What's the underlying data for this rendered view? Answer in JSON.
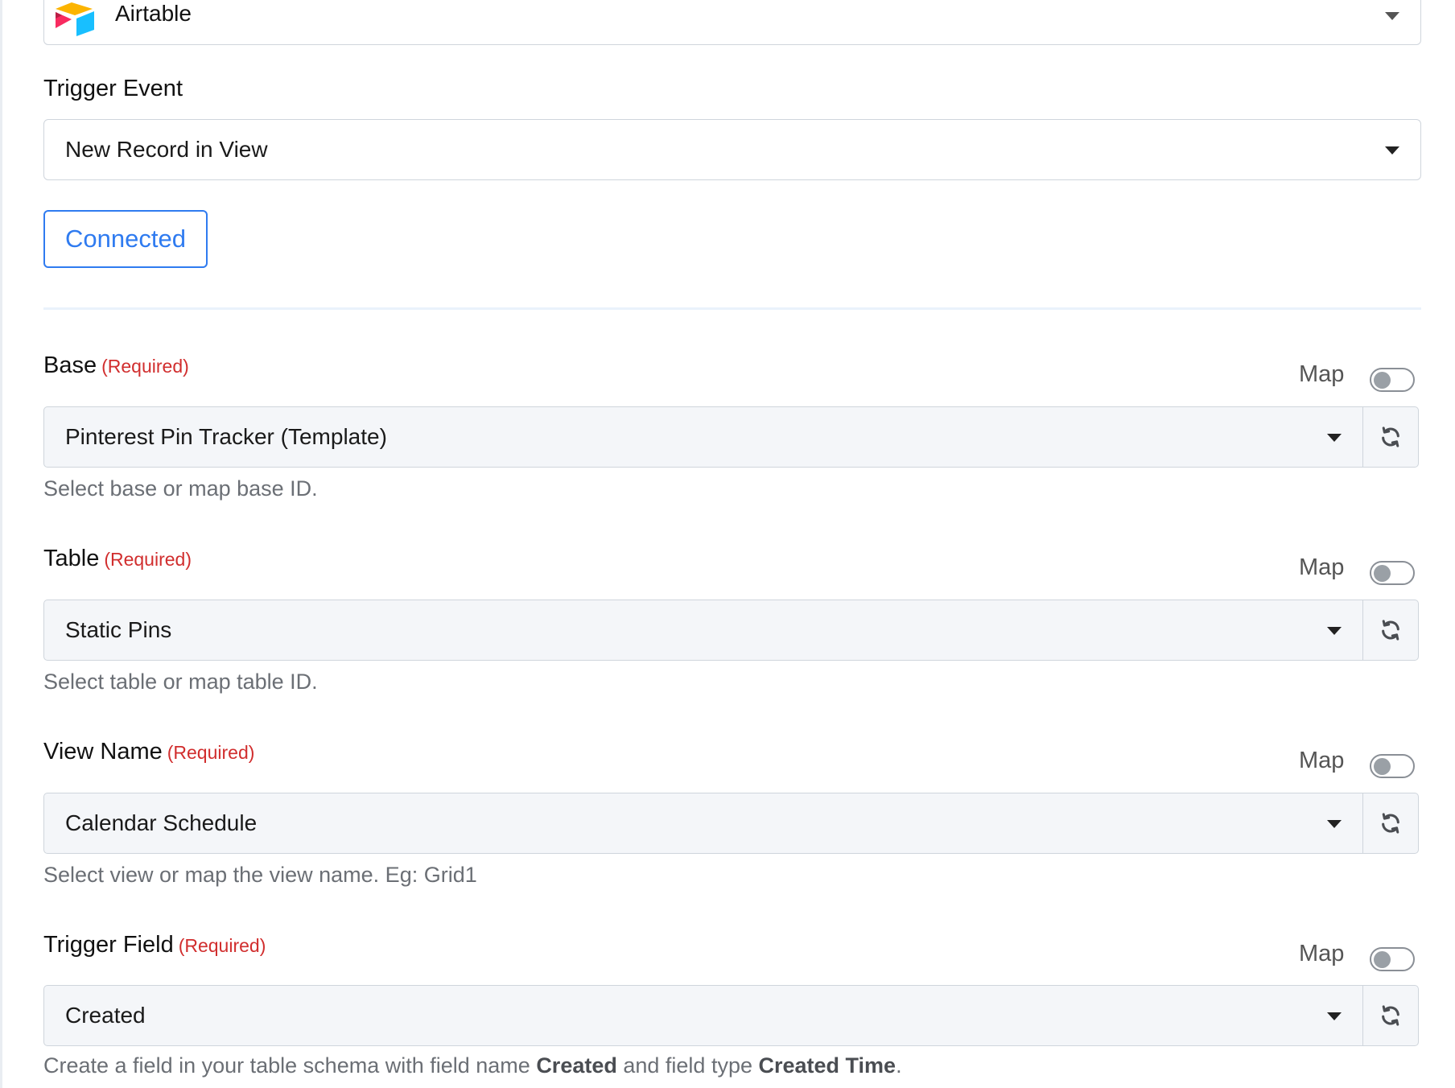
{
  "app_select": {
    "value": "Airtable",
    "logo_icon": "airtable-logo-icon"
  },
  "trigger_event": {
    "label": "Trigger Event",
    "value": "New Record in View"
  },
  "connection": {
    "button_label": "Connected",
    "accent": "#2f7bf0"
  },
  "fields": [
    {
      "label": "Base",
      "required": "(Required)",
      "map_label": "Map",
      "map_enabled": false,
      "value": "Pinterest Pin Tracker (Template)",
      "help": "Select base or map base ID."
    },
    {
      "label": "Table",
      "required": "(Required)",
      "map_label": "Map",
      "map_enabled": false,
      "value": "Static Pins",
      "help": "Select table or map table ID."
    },
    {
      "label": "View Name",
      "required": "(Required)",
      "map_label": "Map",
      "map_enabled": false,
      "value": "Calendar Schedule",
      "help": "Select view or map the view name. Eg: Grid1"
    },
    {
      "label": "Trigger Field",
      "required": "(Required)",
      "map_label": "Map",
      "map_enabled": false,
      "value": "Created",
      "help_parts": {
        "a": "Create a field in your table schema with field name ",
        "b": "Created",
        "c": " and field type ",
        "d": "Created Time",
        "e": "."
      }
    }
  ],
  "colors": {
    "required": "#d12e2e",
    "help_text": "#6b6f75",
    "select_bg": "#f4f6f9"
  }
}
